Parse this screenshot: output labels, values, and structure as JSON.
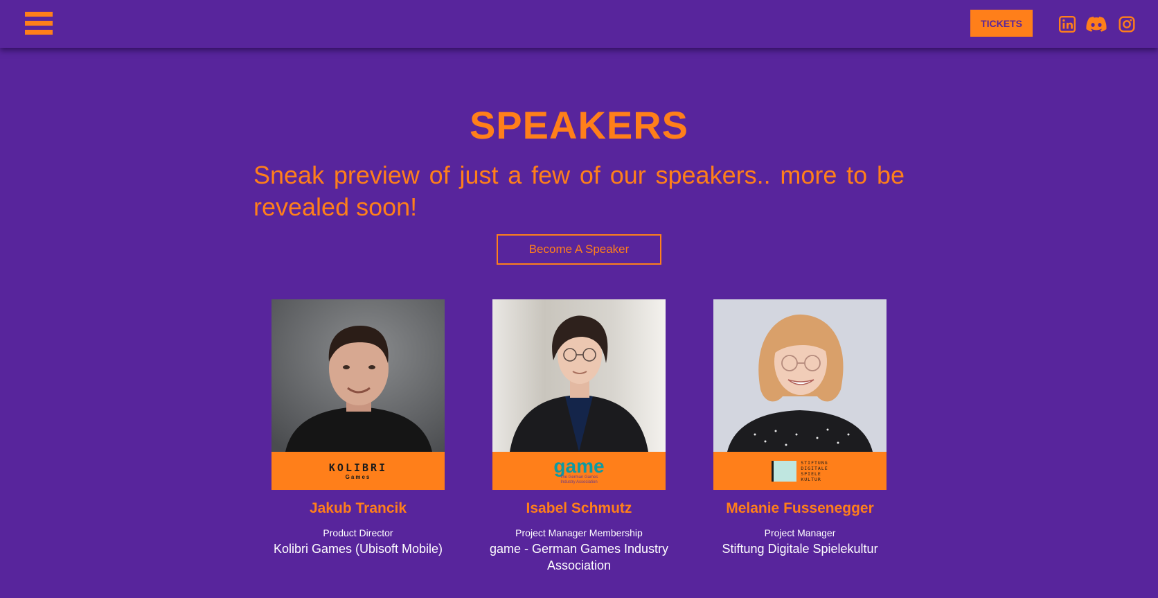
{
  "header": {
    "tickets_label": "TICKETS",
    "social_icons": [
      "linkedin-icon",
      "discord-icon",
      "instagram-icon"
    ]
  },
  "colors": {
    "background": "#58259c",
    "accent": "#ff7f1a",
    "text": "#ffffff"
  },
  "hero": {
    "title": "SPEAKERS",
    "subtitle": "Sneak preview of just a few of our speakers.. more to be revealed soon!",
    "cta_label": "Become A Speaker"
  },
  "speakers": [
    {
      "name": "Jakub Trancik",
      "role": "Product Director",
      "company": "Kolibri Games (Ubisoft Mobile)",
      "logo_text": "KOLIBRI",
      "logo_subtext": "Games"
    },
    {
      "name": "Isabel Schmutz",
      "role": "Project Manager Membership",
      "company": "game - German Games Industry Association",
      "logo_text": "game",
      "logo_subtext_1": "The German Games",
      "logo_subtext_2": "Industry Association"
    },
    {
      "name": "Melanie Fussenegger",
      "role": "Project Manager",
      "company": "Stiftung Digitale Spielekultur",
      "logo_lines": [
        "STIFTUNG",
        "DIGITALE",
        "SPIELE",
        "KULTUR"
      ]
    }
  ]
}
